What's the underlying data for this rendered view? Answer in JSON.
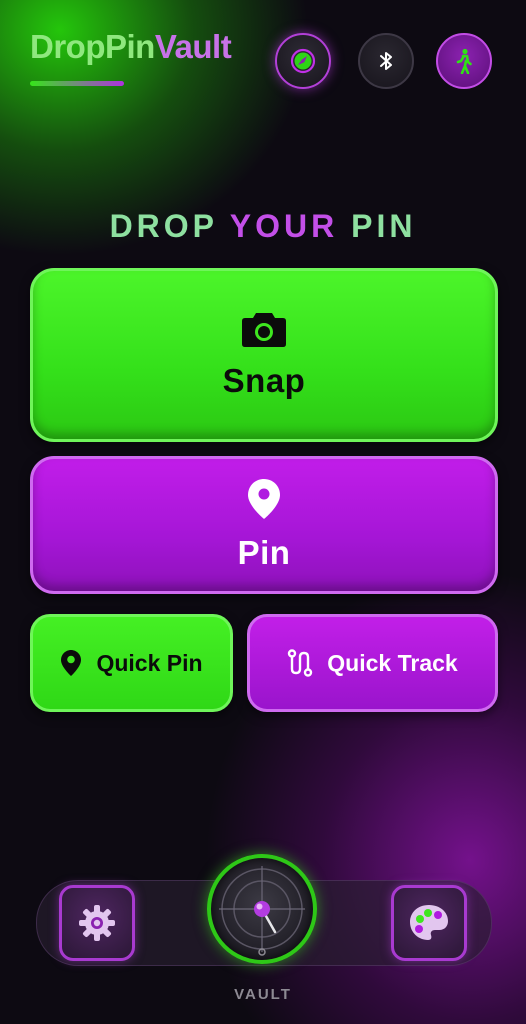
{
  "app": {
    "title_part1": "DropPin",
    "title_part2": "Vault"
  },
  "header_icons": [
    "compass-icon",
    "bluetooth-icon",
    "walking-person-icon"
  ],
  "main": {
    "heading_part1": "DROP",
    "heading_part2": "YOUR",
    "heading_part3": "PIN",
    "snap_label": "Snap",
    "pin_label": "Pin",
    "quick_pin_label": "Quick Pin",
    "quick_track_label": "Quick Track"
  },
  "bottom_nav": {
    "center_label": "VAULT",
    "icons": [
      "gear-icon",
      "vault-dial-icon",
      "palette-icon"
    ]
  },
  "colors": {
    "accent_green": "#34e01a",
    "accent_purple": "#a516d6",
    "background": "#0d0a12"
  }
}
